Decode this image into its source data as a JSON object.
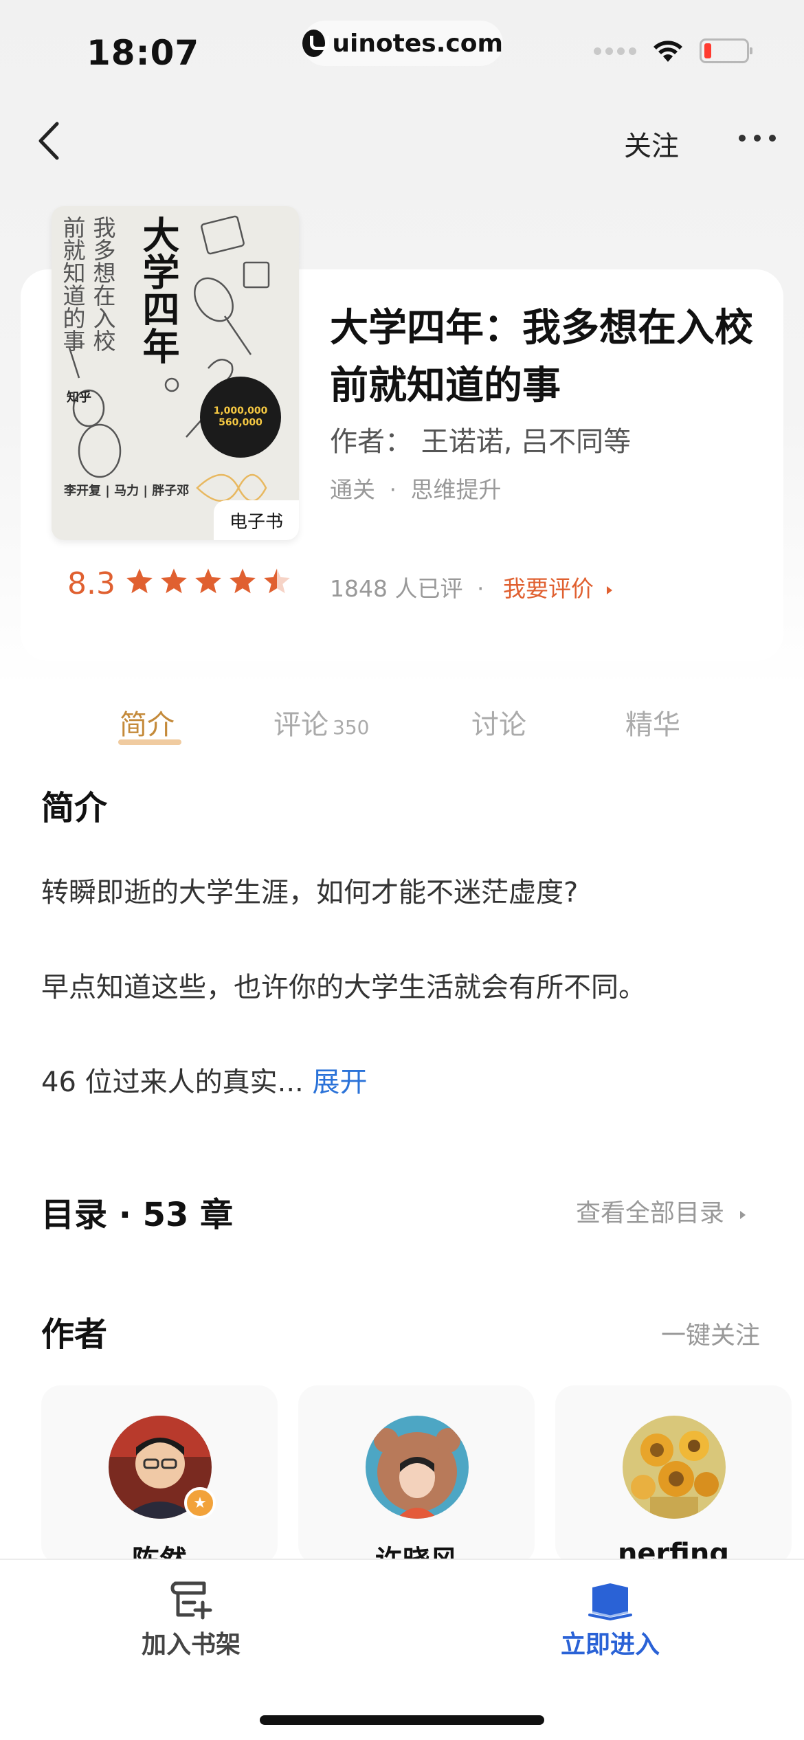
{
  "status_bar": {
    "time": "18:07",
    "url": "uinotes.com"
  },
  "nav": {
    "back_icon": "chevron-left-icon",
    "follow_label": "关注",
    "more_icon": "more-horizontal-icon"
  },
  "book": {
    "cover": {
      "title": "大学四年",
      "subtitle_1": "我多想在入校",
      "subtitle_2": "前就知道的事",
      "badge_line1": "1,000,000",
      "badge_line2": "560,000",
      "brand": "知乎",
      "authors": "李开复 | 马力 | 胖子邓"
    },
    "ebook_tag": "电子书",
    "title": "大学四年：我多想在入校前就知道的事",
    "author_line": "作者：  王诺诺, 吕不同等",
    "tag_1": "通关",
    "tag_separator": "·",
    "tag_2": "思维提升",
    "rating_score": "8.3",
    "rating_stars": 4.5,
    "rating_max": 5,
    "rating_count": "1848 人已评",
    "rating_separator": "·",
    "rate_link": "我要评价",
    "accent_color": "#e06030"
  },
  "tabs": [
    {
      "label": "简介",
      "count": "",
      "active": true
    },
    {
      "label": "评论",
      "count": "350",
      "active": false
    },
    {
      "label": "讨论",
      "count": "",
      "active": false
    },
    {
      "label": "精华",
      "count": "",
      "active": false
    }
  ],
  "intro": {
    "heading": "简介",
    "p1": "转瞬即逝的大学生涯，如何才能不迷茫虚度?",
    "p2": "早点知道这些，也许你的大学生活就会有所不同。",
    "p3": "46 位过来人的真实...",
    "expand": "展开"
  },
  "catalog": {
    "heading": "目录 · 53 章",
    "link": "查看全部目录"
  },
  "authors": {
    "heading": "作者",
    "follow_all": "一键关注",
    "items": [
      {
        "name": "陈然",
        "verified": true
      },
      {
        "name": "许晓风",
        "verified": false
      },
      {
        "name": "nerfing",
        "verified": false
      }
    ]
  },
  "bottom_bar": {
    "add_shelf": "加入书架",
    "read_now": "立即进入",
    "read_color": "#2a62d6"
  }
}
